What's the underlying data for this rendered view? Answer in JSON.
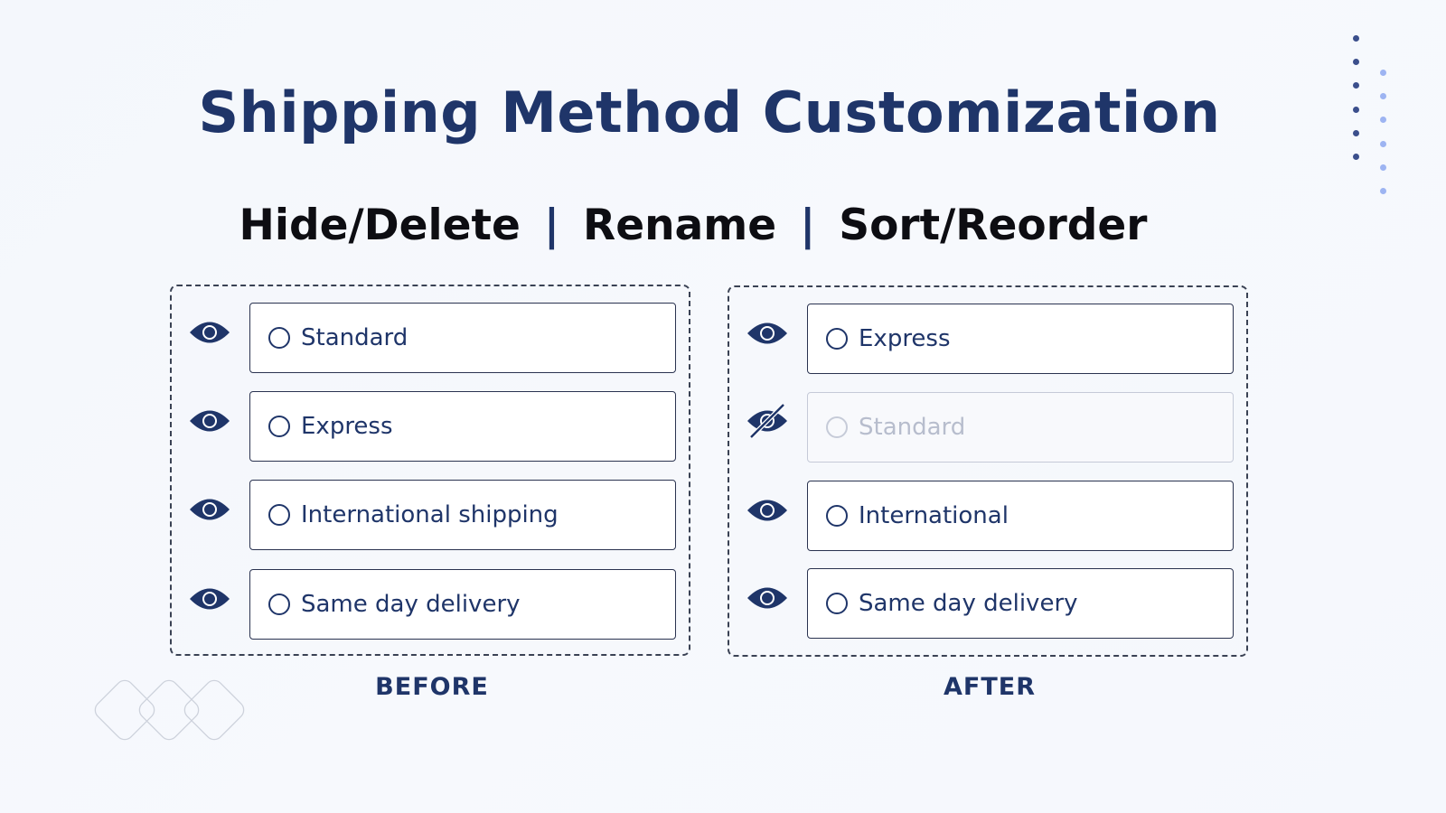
{
  "title": "Shipping Method Customization",
  "subtitle": {
    "items": [
      "Hide/Delete",
      "Rename",
      "Sort/Reorder"
    ],
    "separator": "|"
  },
  "before": {
    "caption": "BEFORE",
    "options": [
      {
        "label": "Standard",
        "visible": true,
        "icon": "eye-icon"
      },
      {
        "label": "Express",
        "visible": true,
        "icon": "eye-icon"
      },
      {
        "label": "International shipping",
        "visible": true,
        "icon": "eye-icon"
      },
      {
        "label": "Same day delivery",
        "visible": true,
        "icon": "eye-icon"
      }
    ]
  },
  "after": {
    "caption": "AFTER",
    "options": [
      {
        "label": "Express",
        "visible": true,
        "icon": "eye-icon"
      },
      {
        "label": "Standard",
        "visible": false,
        "icon": "eye-slash-icon"
      },
      {
        "label": "International",
        "visible": true,
        "icon": "eye-icon"
      },
      {
        "label": "Same day delivery",
        "visible": true,
        "icon": "eye-icon"
      }
    ]
  },
  "colors": {
    "primary": "#1f3569",
    "disabled_text": "#b7bdcd",
    "dot_dark": "#3b4f8c",
    "dot_light": "#9db4f2"
  }
}
